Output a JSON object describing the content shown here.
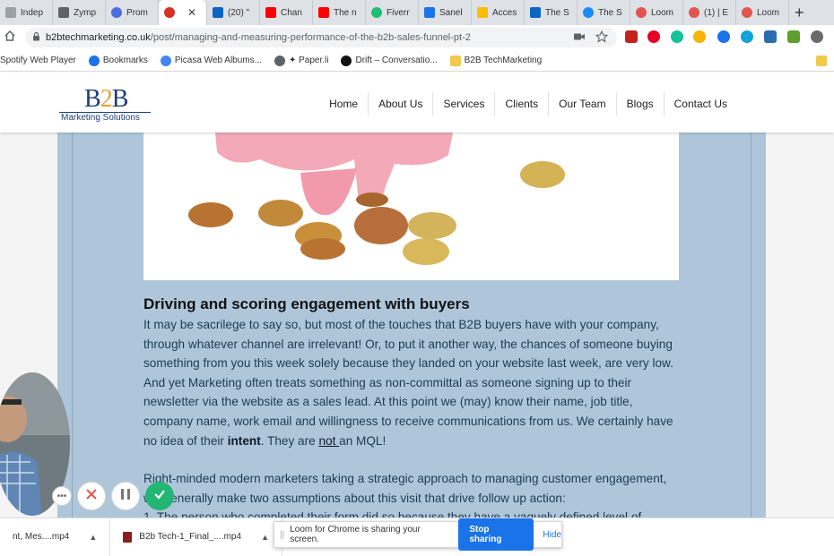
{
  "browser": {
    "tabs": [
      {
        "label": "Indep",
        "icon": "globe-icon",
        "color": "#9aa0a6"
      },
      {
        "label": "Zymp",
        "icon": "zympler-icon",
        "color": "#5f6368"
      },
      {
        "label": "Prom",
        "icon": "prom-icon",
        "color": "#4a6ee0"
      },
      {
        "label": "",
        "icon": "recording-icon",
        "color": "#d93025",
        "active": true
      },
      {
        "label": "(20) \"",
        "icon": "linkedin-icon",
        "color": "#0a66c2"
      },
      {
        "label": "Chan",
        "icon": "youtube-icon",
        "color": "#ff0000"
      },
      {
        "label": "The n",
        "icon": "youtube-icon",
        "color": "#ff0000"
      },
      {
        "label": "Fiverr",
        "icon": "fiverr-icon",
        "color": "#1dbf73"
      },
      {
        "label": "Sanel",
        "icon": "email-icon",
        "color": "#1a73e8"
      },
      {
        "label": "Acces",
        "icon": "drive-icon",
        "color": "#fbbc04"
      },
      {
        "label": "The S",
        "icon": "linkedin-icon",
        "color": "#0a66c2"
      },
      {
        "label": "The S",
        "icon": "safari-icon",
        "color": "#1a8cff"
      },
      {
        "label": "Loom",
        "icon": "loom-icon",
        "color": "#e2554f"
      },
      {
        "label": "(1) | E",
        "icon": "loom-icon",
        "color": "#e2554f"
      },
      {
        "label": "Loom",
        "icon": "loom-icon",
        "color": "#e2554f"
      }
    ],
    "url_host": "b2btechmarketing.co.uk",
    "url_path": "/post/managing-and-measuring-performance-of-the-b2b-sales-funnel-pt-2",
    "bookmarks": [
      {
        "label": "Spotify Web Player",
        "icon": ""
      },
      {
        "label": "Bookmarks",
        "icon": "star-icon"
      },
      {
        "label": "Picasa Web Albums...",
        "icon": "google-icon"
      },
      {
        "label": "✦ Paper.li",
        "icon": "globe-icon"
      },
      {
        "label": "Drift – Conversatio...",
        "icon": "drift-icon"
      },
      {
        "label": "B2B TechMarketing",
        "icon": "folder-icon"
      }
    ]
  },
  "site": {
    "logo_main": "B2B",
    "logo_tagline": "Marketing Solutions",
    "nav": [
      "Home",
      "About Us",
      "Services",
      "Clients",
      "Our Team",
      "Blogs",
      "Contact Us"
    ]
  },
  "article": {
    "heading": "Driving and scoring engagement with buyers",
    "p1_a": "It may be sacrilege to say so, but most of the touches that B2B buyers have with your company, through whatever channel are irrelevant! Or, to put it another way, the chances of someone buying something from you this week solely because they landed on your website last week, are very low. And yet Marketing often treats something as non-committal as someone signing up to their newsletter via the website as a sales lead. At this point we (may) know their name, job title, company name, work email and willingness to receive communications from us. We certainly have no idea of their ",
    "p1_bold": "intent",
    "p1_b": ". They are ",
    "p1_under": "not ",
    "p1_c": "an MQL!",
    "p2": "Right-minded modern marketers taking a strategic approach to managing customer engagement, will generally make two assumptions about this visit that drive follow up action:",
    "p3": "1. The person who completed their form did so because they have a vaguely defined level of"
  },
  "downloads": [
    {
      "label": "nt, Mes....mp4"
    },
    {
      "label": "B2b Tech-1_Final_....mp4"
    }
  ],
  "share_bar": {
    "message": "Loom for Chrome is sharing your screen.",
    "stop_label": "Stop sharing",
    "hide_label": "Hide"
  },
  "colors": {
    "accent": "#1a73e8",
    "panel": "#afc6da",
    "brand": "#1c3f77"
  }
}
